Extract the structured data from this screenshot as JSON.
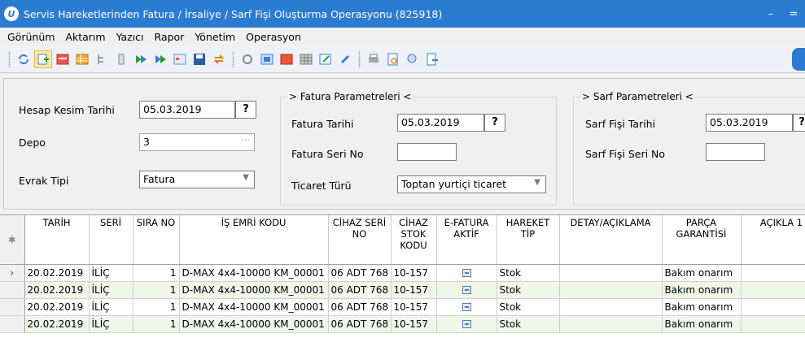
{
  "window": {
    "title": "Servis Hareketlerinden Fatura / İrsaliye / Sarf Fişi Oluşturma Operasyonu (825918)",
    "app_icon_letter": "U",
    "minimize": "–",
    "maximize": "="
  },
  "menu": [
    "Görünüm",
    "Aktarım",
    "Yazıcı",
    "Rapor",
    "Yönetim",
    "Operasyon"
  ],
  "toolbar": {
    "icons": [
      "refresh-icon",
      "add-icon",
      "list-icon",
      "grid-icon",
      "tree-icon",
      "column-icon",
      "forward-icon",
      "forward-all-icon",
      "calendar-icon",
      "save-icon",
      "transfer-icon",
      "tools-icon",
      "view-icon",
      "color-icon",
      "table-icon",
      "edit-icon",
      "clip-icon",
      "print-icon",
      "preview-icon",
      "print-settings-icon",
      "export-icon"
    ]
  },
  "form": {
    "hesap_kesim_label": "Hesap Kesim Tarihi",
    "hesap_kesim_value": "05.03.2019",
    "depo_label": "Depo",
    "depo_value": "3",
    "depo_ellipsis": "···",
    "evrak_tipi_label": "Evrak Tipi",
    "evrak_tipi_value": "Fatura",
    "q": "?",
    "fatura_group_title": "> Fatura Parametreleri <",
    "fatura_tarihi_label": "Fatura Tarihi",
    "fatura_tarihi_value": "05.03.2019",
    "fatura_seri_label": "Fatura Seri No",
    "fatura_seri_value": "",
    "ticaret_turu_label": "Ticaret Türü",
    "ticaret_turu_value": "Toptan yurtiçi ticaret",
    "sarf_group_title": "> Sarf Parametreleri <",
    "sarf_tarihi_label": "Sarf Fişi Tarihi",
    "sarf_tarihi_value": "05.03.2019",
    "sarf_seri_label": "Sarf Fişi Seri No",
    "sarf_seri_value": ""
  },
  "grid": {
    "indicator_header": "✱",
    "columns": [
      "TARİH",
      "SERİ",
      "SIRA NO",
      "İŞ EMRİ KODU",
      "CİHAZ SERİ NO",
      "CİHAZ STOK KODU",
      "E-FATURA AKTİF",
      "HAREKET TİP",
      "DETAY/AÇIKLAMA",
      "PARÇA GARANTİSİ",
      "AÇIKLA 1"
    ],
    "rows": [
      {
        "indicator": "›",
        "tarih": "20.02.2019",
        "seri": "İLİÇ",
        "sira": "1",
        "is_emri": "D-MAX 4x4-10000 KM_00001",
        "cihaz_seri": "06 ADT 768",
        "stok_kodu": "10-157",
        "hareket": "Stok",
        "detay": "",
        "parca": "Bakım onarım",
        "aciklama": ""
      },
      {
        "indicator": "",
        "tarih": "20.02.2019",
        "seri": "İLİÇ",
        "sira": "1",
        "is_emri": "D-MAX 4x4-10000 KM_00001",
        "cihaz_seri": "06 ADT 768",
        "stok_kodu": "10-157",
        "hareket": "Stok",
        "detay": "",
        "parca": "Bakım onarım",
        "aciklama": ""
      },
      {
        "indicator": "",
        "tarih": "20.02.2019",
        "seri": "İLİÇ",
        "sira": "1",
        "is_emri": "D-MAX 4x4-10000 KM_00001",
        "cihaz_seri": "06 ADT 768",
        "stok_kodu": "10-157",
        "hareket": "Stok",
        "detay": "",
        "parca": "Bakım onarım",
        "aciklama": ""
      },
      {
        "indicator": "",
        "tarih": "20.02.2019",
        "seri": "İLİÇ",
        "sira": "1",
        "is_emri": "D-MAX 4x4-10000 KM_00001",
        "cihaz_seri": "06 ADT 768",
        "stok_kodu": "10-157",
        "hareket": "Stok",
        "detay": "",
        "parca": "Bakım onarım",
        "aciklama": ""
      }
    ]
  }
}
